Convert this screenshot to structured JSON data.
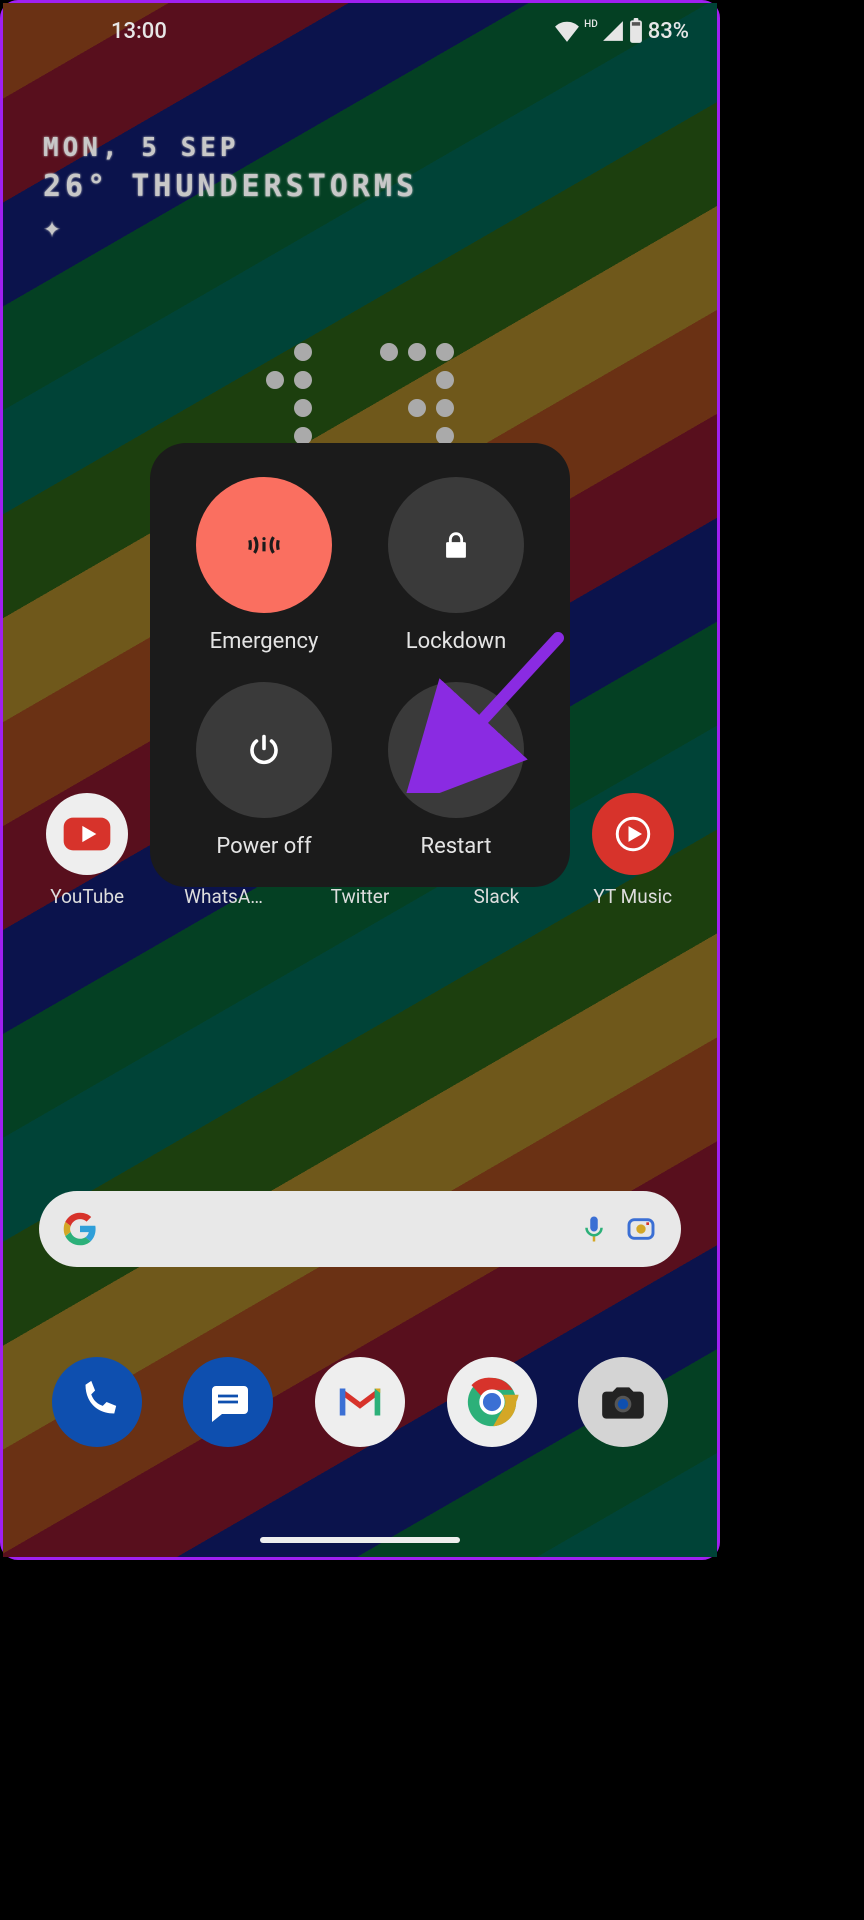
{
  "status": {
    "time": "13:00",
    "battery_pct": "83%",
    "hd_badge": "HD"
  },
  "weather": {
    "date_line": "MON, 5 SEP",
    "temp_line": "26° THUNDERSTORMS"
  },
  "big_clock": {
    "digits": "13"
  },
  "power_menu": {
    "emergency": "Emergency",
    "lockdown": "Lockdown",
    "power_off": "Power off",
    "restart": "Restart"
  },
  "apps": {
    "youtube": "YouTube",
    "whatsapp": "WhatsA…",
    "twitter": "Twitter",
    "slack": "Slack",
    "yt_music": "YT Music"
  },
  "dock": {
    "phone": "phone",
    "messages": "messages",
    "gmail": "gmail",
    "chrome": "chrome",
    "camera": "camera"
  },
  "colors": {
    "emergency": "#fa6f60",
    "dark_circle": "#3a3a3a",
    "arrow": "#8a2be2"
  }
}
